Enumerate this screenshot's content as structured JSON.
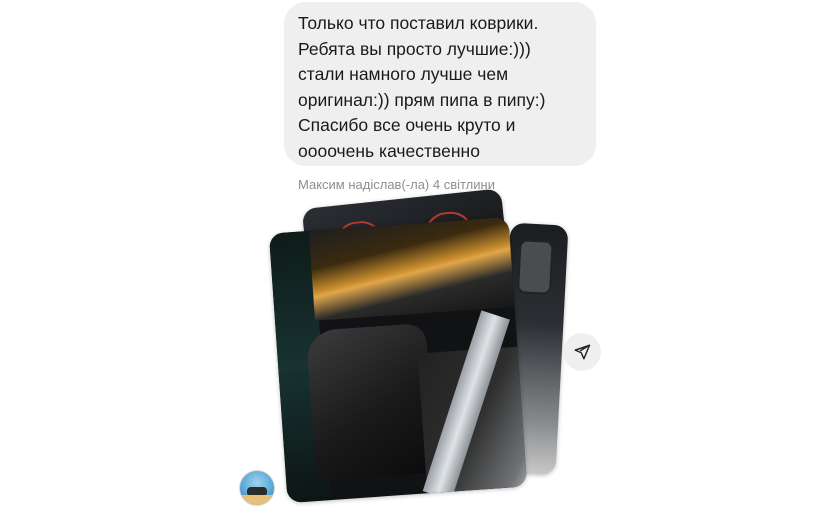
{
  "message": {
    "lines": [
      "Только что поставил коврики.",
      "Ребята вы просто лучшие:)))",
      "стали намного лучше чем",
      "оригинал:)) прям пипа в пипу:)",
      "Спасибо все очень круто и",
      "оооочень качественно"
    ]
  },
  "photo_meta": {
    "caption": "Максим надіслав(-ла) 4 світлини"
  },
  "icons": {
    "share": "paper-plane-icon",
    "avatar": "user-avatar"
  },
  "colors": {
    "bubble": "#efefef",
    "meta_text": "#8e8e8e"
  }
}
